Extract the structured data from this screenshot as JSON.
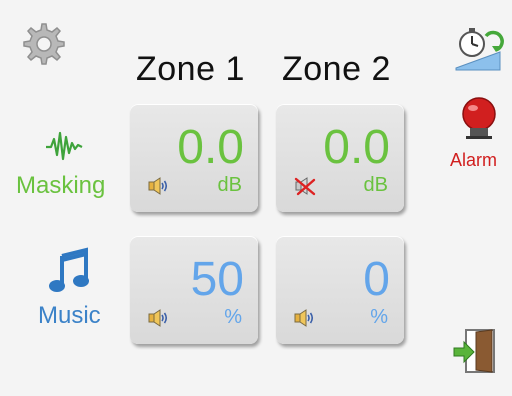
{
  "zones": [
    {
      "label": "Zone 1"
    },
    {
      "label": "Zone 2"
    }
  ],
  "rows": {
    "masking": {
      "label": "Masking",
      "color": "#6ac23f"
    },
    "music": {
      "label": "Music",
      "color": "#3b82c8"
    }
  },
  "tiles": {
    "masking_zone1": {
      "value": "0.0",
      "unit": "dB",
      "muted": false
    },
    "masking_zone2": {
      "value": "0.0",
      "unit": "dB",
      "muted": true
    },
    "music_zone1": {
      "value": "50",
      "unit": "%",
      "muted": false
    },
    "music_zone2": {
      "value": "0",
      "unit": "%",
      "muted": false
    }
  },
  "sidebar": {
    "alarm_label": "Alarm"
  },
  "icons": {
    "settings": "gear-icon",
    "scheduler": "clock-sync-icon",
    "alarm": "bell-icon",
    "exit": "door-exit-icon",
    "masking": "waveform-icon",
    "music": "music-note-icon",
    "speaker": "speaker-icon",
    "muted": "speaker-muted-icon"
  },
  "colors": {
    "masking_value": "#6ac23f",
    "music_value": "#63a5ea",
    "alarm": "#d11f1f"
  }
}
